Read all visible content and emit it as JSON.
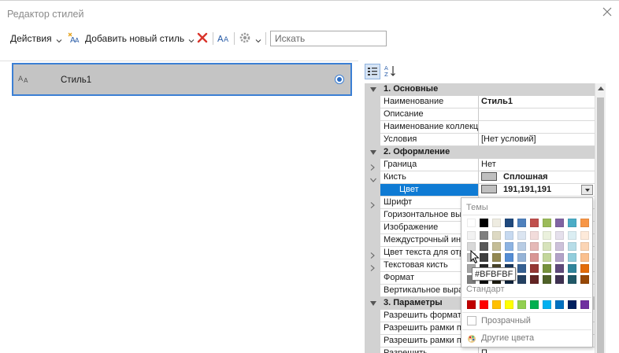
{
  "window": {
    "title": "Редактор стилей",
    "close_icon": "close-icon"
  },
  "toolbar": {
    "actions_label": "Действия",
    "add_style_label": "Добавить новый стиль",
    "search_placeholder": "Искать"
  },
  "styles_list": [
    {
      "label": "Стиль1",
      "icon": "text-style-icon",
      "selected": true
    }
  ],
  "property_grid": {
    "categories": [
      {
        "label": "1. Основные",
        "rows": [
          {
            "key": "Наименование",
            "value": "Стиль1",
            "bold": true
          },
          {
            "key": "Описание",
            "value": ""
          },
          {
            "key": "Наименование коллекции",
            "value": ""
          },
          {
            "key": "Условия",
            "value": "[Нет условий]"
          }
        ]
      },
      {
        "label": "2. Оформление",
        "rows": [
          {
            "key": "Граница",
            "value": "Нет",
            "expandable": true
          },
          {
            "key": "Кисть",
            "value": "Сплошная",
            "bold": true,
            "expanded": true,
            "swatch": "#bfbfbf"
          },
          {
            "key": "Цвет",
            "value": "191,191,191",
            "bold": true,
            "selected": true,
            "swatch": "#bfbfbf"
          },
          {
            "key": "Шрифт",
            "value": "",
            "expandable": true
          },
          {
            "key": "Горизонтальное выравнивание",
            "value": ""
          },
          {
            "key": "Изображение",
            "value": ""
          },
          {
            "key": "Междустрочный интервал",
            "value": ""
          },
          {
            "key": "Цвет текста для отрицательных",
            "value": "",
            "expandable": true
          },
          {
            "key": "Текстовая кисть",
            "value": "",
            "expandable": true
          },
          {
            "key": "Формат",
            "value": ""
          },
          {
            "key": "Вертикальное выравнивание",
            "value": ""
          }
        ]
      },
      {
        "label": "3. Параметры",
        "rows": [
          {
            "key": "Разрешить форматирование",
            "value": ""
          },
          {
            "key": "Разрешить рамки по",
            "value": ""
          },
          {
            "key": "Разрешить рамки по",
            "value": ""
          },
          {
            "key": "Разрешить",
            "value": "П"
          }
        ]
      }
    ]
  },
  "color_popup": {
    "themes_label": "Темы",
    "standard_label": "Стандарт",
    "transparent_label": "Прозрачный",
    "more_colors_label": "Другие цвета",
    "tooltip": "#BFBFBF",
    "theme_top_row": [
      "#ffffff",
      "#000000",
      "#eeece1",
      "#1f497d",
      "#4f81bd",
      "#c0504d",
      "#9bbb59",
      "#8064a2",
      "#4bacc6",
      "#f79646"
    ],
    "theme_shades": [
      [
        "#f2f2f2",
        "#7f7f7f",
        "#ddd9c3",
        "#c6d9f0",
        "#dbe5f1",
        "#f2dcdb",
        "#ebf1dd",
        "#e5e0ec",
        "#dbeef3",
        "#fdeada"
      ],
      [
        "#d8d8d8",
        "#595959",
        "#c4bd97",
        "#8db3e2",
        "#b8cce4",
        "#e5b9b7",
        "#d7e3bc",
        "#ccc1d9",
        "#b7dde8",
        "#fbd5b5"
      ],
      [
        "#bfbfbf",
        "#3f3f3f",
        "#938953",
        "#548dd4",
        "#95b3d7",
        "#d99694",
        "#c3d69b",
        "#b2a2c7",
        "#92cddc",
        "#fac08f"
      ],
      [
        "#a5a5a5",
        "#262626",
        "#494429",
        "#17365d",
        "#366092",
        "#953734",
        "#76923c",
        "#5f497a",
        "#31859b",
        "#e36c09"
      ],
      [
        "#7f7f7f",
        "#0c0c0c",
        "#1d1b10",
        "#0f243e",
        "#244061",
        "#632423",
        "#4f6128",
        "#3f3151",
        "#205867",
        "#974806"
      ]
    ],
    "standard_colors": [
      "#c00000",
      "#ff0000",
      "#ffc000",
      "#ffff00",
      "#92d050",
      "#00b050",
      "#00b0f0",
      "#0070c0",
      "#002060",
      "#7030a0"
    ]
  }
}
